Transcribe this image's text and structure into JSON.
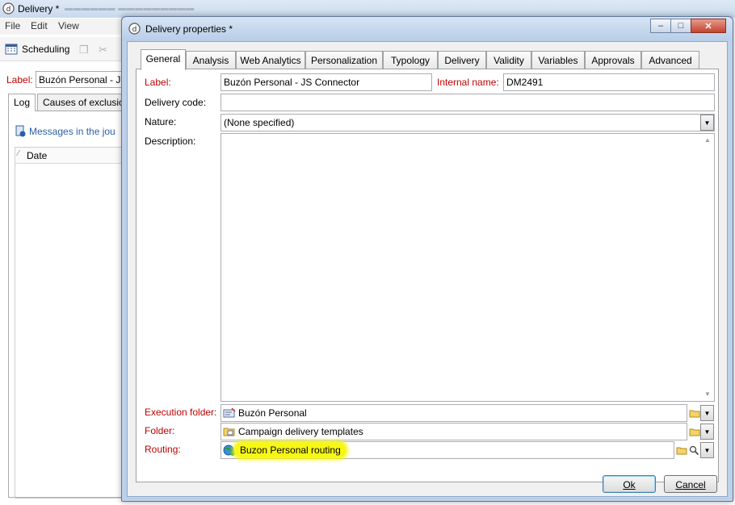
{
  "background_window": {
    "title": "Delivery *",
    "menu": [
      "File",
      "Edit",
      "View"
    ],
    "toolbar": {
      "scheduling_label": "Scheduling"
    },
    "label_field": {
      "label": "Label:",
      "value": "Buzón Personal - JS"
    },
    "tabs": [
      "Log",
      "Causes of exclusio"
    ],
    "messages_link": "Messages in the jou",
    "list_header": "Date"
  },
  "dialog": {
    "title": "Delivery properties *",
    "window_buttons": {
      "minimize": "–",
      "maximize": "□",
      "close": "✕"
    },
    "tabs": [
      {
        "label": "General",
        "active": true
      },
      {
        "label": "Analysis"
      },
      {
        "label": "Web Analytics"
      },
      {
        "label": "Personalization"
      },
      {
        "label": "Typology"
      },
      {
        "label": "Delivery"
      },
      {
        "label": "Validity"
      },
      {
        "label": "Variables"
      },
      {
        "label": "Approvals"
      },
      {
        "label": "Advanced"
      }
    ],
    "general": {
      "label": {
        "label": "Label:",
        "value": "Buzón Personal - JS Connector"
      },
      "internal_name": {
        "label": "Internal name:",
        "value": "DM2491"
      },
      "delivery_code": {
        "label": "Delivery code:",
        "value": ""
      },
      "nature": {
        "label": "Nature:",
        "value": "(None specified)"
      },
      "description": {
        "label": "Description:",
        "value": ""
      },
      "execution_folder": {
        "label": "Execution folder:",
        "value": "Buzón Personal"
      },
      "folder": {
        "label": "Folder:",
        "value": "Campaign delivery templates"
      },
      "routing": {
        "label": "Routing:",
        "value": "Buzon Personal routing"
      }
    },
    "buttons": {
      "ok": "Ok",
      "cancel": "Cancel"
    }
  },
  "colors": {
    "required_label": "#c00000",
    "highlight": "#f7f716",
    "link": "#2a5ea8"
  }
}
